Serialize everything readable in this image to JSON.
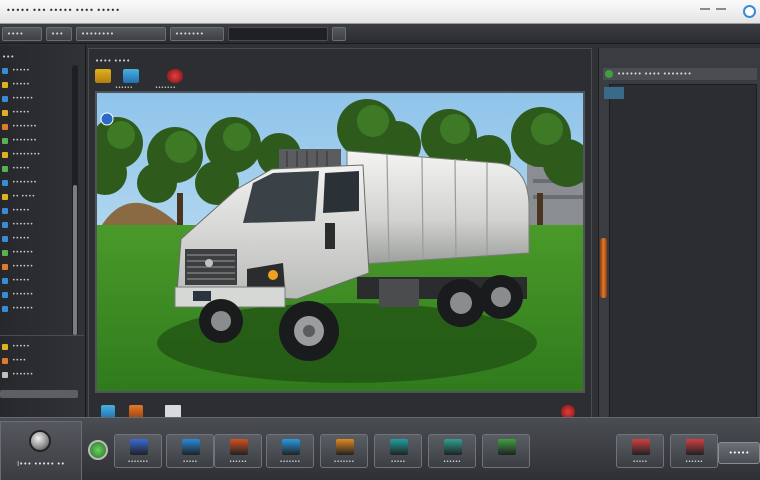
{
  "window": {
    "title": "••••• ••• ••••• •••• •••••"
  },
  "toolbar": {
    "buttons": [
      "••••",
      "•••",
      "••••••••",
      "•••••••"
    ],
    "search_value": ""
  },
  "sidebar": {
    "heading": "•••",
    "items": [
      {
        "label": "•••••",
        "color": "#3a8ad8"
      },
      {
        "label": "•••••",
        "color": "#e0b020"
      },
      {
        "label": "••••••",
        "color": "#3a8ad8"
      },
      {
        "label": "•••••",
        "color": "#e0b020"
      },
      {
        "label": "•••••••",
        "color": "#e07a2a"
      },
      {
        "label": "•••••••",
        "color": "#5ab050"
      },
      {
        "label": "••••••••",
        "color": "#e0b020"
      },
      {
        "label": "•••••",
        "color": "#5ab050"
      },
      {
        "label": "•••••••",
        "color": "#3a8ad8"
      },
      {
        "label": "•• ••••",
        "color": "#e0b020"
      },
      {
        "label": "•••••",
        "color": "#3a8ad8"
      },
      {
        "label": "••••••",
        "color": "#3a8ad8"
      },
      {
        "label": "•••••",
        "color": "#3a8ad8"
      },
      {
        "label": "••••••",
        "color": "#5ab050"
      },
      {
        "label": "••••••",
        "color": "#e07a2a"
      },
      {
        "label": "•••••",
        "color": "#3a8ad8"
      },
      {
        "label": "••••••",
        "color": "#3a8ad8"
      },
      {
        "label": "••••••",
        "color": "#3a8ad8"
      }
    ],
    "lower_items": [
      {
        "label": "•••••",
        "color": "#e0b020"
      },
      {
        "label": "••••",
        "color": "#e07a2a"
      },
      {
        "label": "••••••",
        "color": "#c0c0c0"
      }
    ]
  },
  "viewport": {
    "tab_label": "•••• ••••",
    "tool_labels": [
      "••••••",
      "•••••••"
    ]
  },
  "right_panel": {
    "heading": "•••••• •••• •••••••"
  },
  "dock": {
    "left_label": "I••• ••••• ••",
    "buttons": [
      {
        "label": "•••••••",
        "color": "#3a6ad8"
      },
      {
        "label": "•••••",
        "color": "#2a8ad8"
      },
      {
        "label": "••••••",
        "color": "#d05020"
      },
      {
        "label": "•••••••",
        "color": "#2a9ae0"
      },
      {
        "label": "•••••••",
        "color": "#e08a20"
      },
      {
        "label": "•••••",
        "color": "#20a0a0"
      },
      {
        "label": "••••••",
        "color": "#30a090"
      },
      {
        "label": "",
        "color": "#40a040"
      },
      {
        "label": "•••••",
        "color": "#d04040"
      },
      {
        "label": "••••••",
        "color": "#d04040"
      }
    ],
    "final_label": "•••••"
  },
  "colors": {
    "accent_orange": "#e07a2a",
    "grass": "#3f8f24",
    "sky": "#b8d8f0"
  }
}
